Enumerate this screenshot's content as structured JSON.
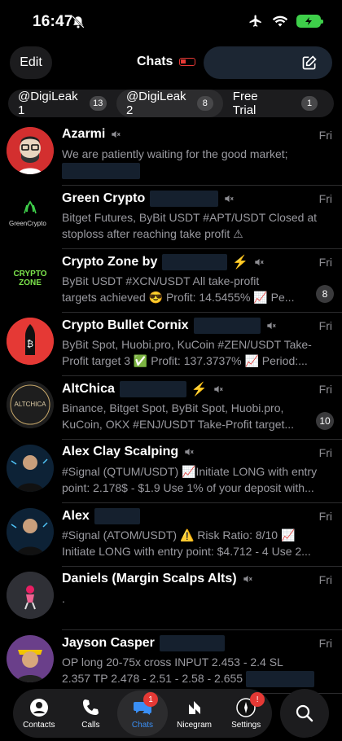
{
  "status": {
    "time": "16:47"
  },
  "header": {
    "edit_label": "Edit",
    "title": "Chats"
  },
  "folders": [
    {
      "label": "@DigiLeak 1",
      "count": "13"
    },
    {
      "label": "@DigiLeak 2",
      "count": "8"
    },
    {
      "label": "Free Trial",
      "count": "1"
    }
  ],
  "chats": [
    {
      "name": "Azarmi",
      "date": "Fri",
      "line1": "We are patiently waiting for the good market;",
      "line2": ""
    },
    {
      "name": "Green Crypto",
      "date": "Fri",
      "line1": "Bitget Futures, ByBit USDT #APT/USDT Closed at",
      "line2": "stoploss after reaching take profit ⚠"
    },
    {
      "name": "Crypto Zone by",
      "date": "Fri",
      "line1": "ByBit USDT #XCN/USDT All take-profit",
      "line2": "targets achieved 😎 Profit: 14.5455% 📈 Pe...",
      "unread": "8"
    },
    {
      "name": "Crypto Bullet Cornix",
      "date": "Fri",
      "line1": "ByBit Spot, Huobi.pro, KuCoin #ZEN/USDT Take-",
      "line2": "Profit target 3 ✅ Profit: 137.3737% 📈 Period:..."
    },
    {
      "name": "AltChica",
      "date": "Fri",
      "line1": "Binance, Bitget Spot, ByBit Spot, Huobi.pro,",
      "line2": "KuCoin, OKX #ENJ/USDT Take-Profit target...",
      "unread": "10"
    },
    {
      "name": "Alex Clay Scalping",
      "date": "Fri",
      "line1": "#Signal (QTUM/USDT) 📈Initiate LONG with entry",
      "line2": "point: 2.178$ - $1.9 Use 1% of your deposit with..."
    },
    {
      "name": "Alex",
      "date": "Fri",
      "line1": "#Signal (ATOM/USDT) ⚠️ Risk Ratio: 8/10 📈",
      "line2": "Initiate LONG with entry point: $4.712 - 4 Use 2..."
    },
    {
      "name": "Daniels (Margin Scalps Alts)",
      "date": "Fri",
      "line1": ".",
      "line2": ""
    },
    {
      "name": "Jayson Casper",
      "date": "Fri",
      "line1": "OP long 20-75x cross INPUT 2.453 - 2.4 SL",
      "line2": "2.357 TP 2.478 - 2.51 - 2.58 - 2.655"
    }
  ],
  "avatar_text": {
    "green": "GreenCrypto",
    "zone": "CRYPTO ZONE",
    "altchica": "ALTCHICA"
  },
  "tabs": [
    {
      "label": "Contacts",
      "icon": "person-icon"
    },
    {
      "label": "Calls",
      "icon": "phone-icon"
    },
    {
      "label": "Chats",
      "icon": "chat-bubbles-icon",
      "badge": "1"
    },
    {
      "label": "Nicegram",
      "icon": "nicegram-icon"
    },
    {
      "label": "Settings",
      "icon": "settings-icon",
      "badge": "!"
    }
  ],
  "colors": {
    "accent": "#3a8ff5",
    "badge_red": "#e53935",
    "battery_green": "#3ecf4a"
  }
}
